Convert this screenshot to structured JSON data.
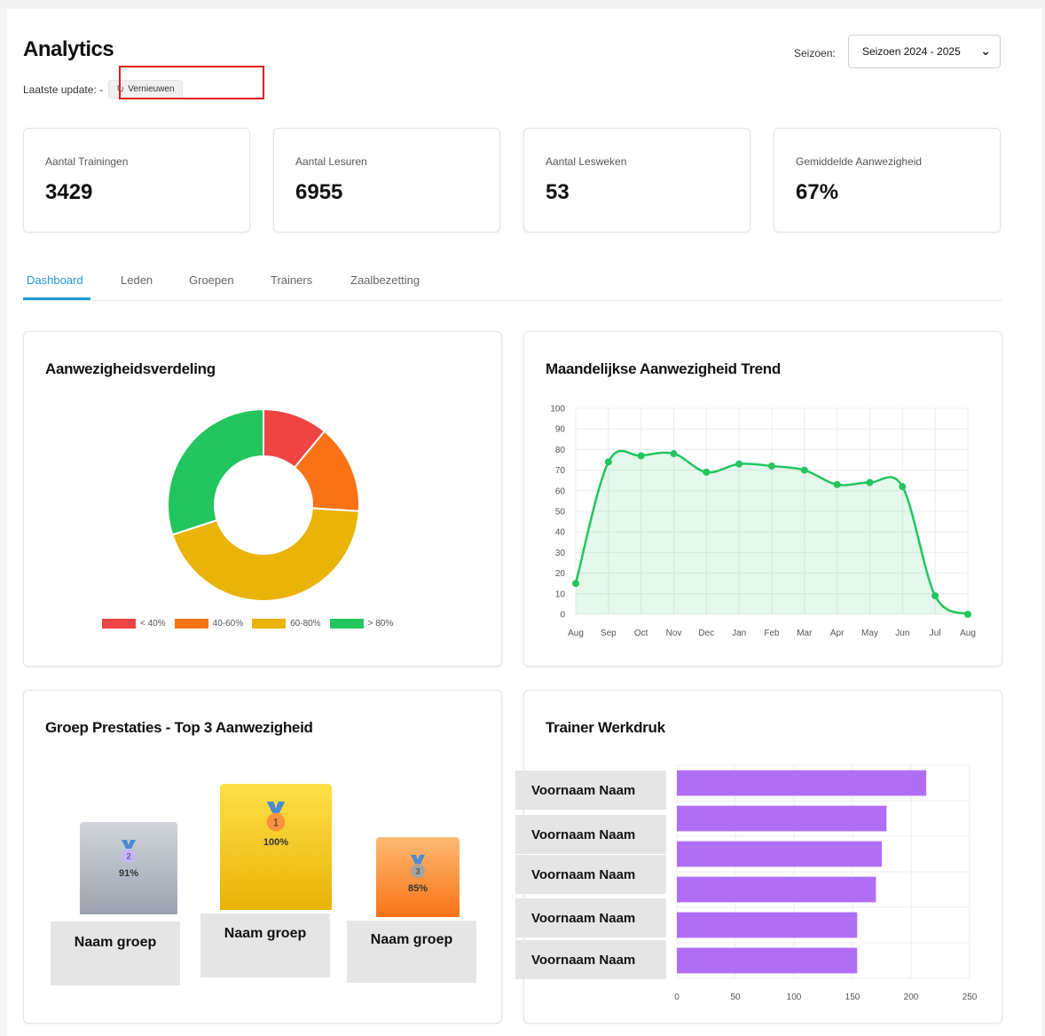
{
  "header": {
    "title": "Analytics",
    "last_update_label": "Laatste update: -",
    "refresh_label": "Vernieuwen",
    "season_label": "Seizoen:",
    "season_selected": "Seizoen 2024 - 2025"
  },
  "stats": [
    {
      "label": "Aantal Trainingen",
      "value": "3429"
    },
    {
      "label": "Aantal Lesuren",
      "value": "6955"
    },
    {
      "label": "Aantal Lesweken",
      "value": "53"
    },
    {
      "label": "Gemiddelde Aanwezigheid",
      "value": "67%"
    }
  ],
  "tabs": [
    {
      "label": "Dashboard",
      "active": true
    },
    {
      "label": "Leden",
      "active": false
    },
    {
      "label": "Groepen",
      "active": false
    },
    {
      "label": "Trainers",
      "active": false
    },
    {
      "label": "Zaalbezetting",
      "active": false
    }
  ],
  "colors": {
    "accent": "#1e9cd7",
    "red": "#ef4444",
    "orange": "#f97316",
    "yellow": "#eab308",
    "green": "#22c55e",
    "purple": "#b06ef5"
  },
  "panels": {
    "distribution_title": "Aanwezigheidsverdeling",
    "trend_title": "Maandelijkse Aanwezigheid Trend",
    "podium_title": "Groep Prestaties - Top 3 Aanwezigheid",
    "workload_title": "Trainer Werkdruk"
  },
  "chart_data": [
    {
      "type": "pie",
      "title": "Aanwezigheidsverdeling",
      "categories": [
        "< 40%",
        "40-60%",
        "60-80%",
        "> 80%"
      ],
      "values": [
        11,
        15,
        44,
        30
      ],
      "legend": "bottom",
      "colors": [
        "#ef4444",
        "#f97316",
        "#eab308",
        "#22c55e"
      ]
    },
    {
      "type": "area",
      "title": "Maandelijkse Aanwezigheid Trend",
      "x": [
        "Aug",
        "Sep",
        "Oct",
        "Nov",
        "Dec",
        "Jan",
        "Feb",
        "Mar",
        "Apr",
        "May",
        "Jun",
        "Jul",
        "Aug"
      ],
      "values": [
        15,
        74,
        77,
        78,
        69,
        73,
        72,
        70,
        63,
        64,
        62,
        9,
        0
      ],
      "ylim": [
        0,
        100
      ],
      "yticks": [
        0,
        10,
        20,
        30,
        40,
        50,
        60,
        70,
        80,
        90,
        100
      ],
      "grid": true,
      "color": "#22c55e"
    },
    {
      "type": "bar",
      "title": "Trainer Werkdruk",
      "orientation": "horizontal",
      "categories": [
        "Voornaam Naam",
        "Voornaam Naam",
        "Voornaam Naam",
        "Voornaam Naam",
        "Voornaam Naam"
      ],
      "values": [
        213,
        179,
        175,
        170,
        154,
        154
      ],
      "xlim": [
        0,
        250
      ],
      "xticks": [
        0,
        50,
        100,
        150,
        200,
        250
      ],
      "grid": true,
      "color": "#b06ef5"
    }
  ],
  "podium": [
    {
      "rank": "2",
      "pct": "91%",
      "name": "Naam groep"
    },
    {
      "rank": "1",
      "pct": "100%",
      "name": "Naam groep"
    },
    {
      "rank": "3",
      "pct": "85%",
      "name": "Naam groep"
    }
  ]
}
